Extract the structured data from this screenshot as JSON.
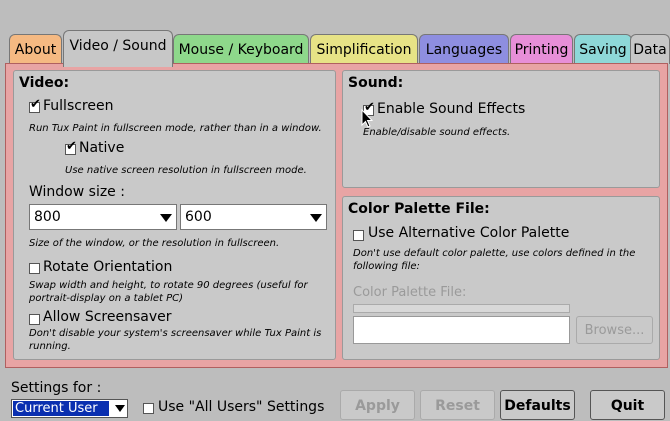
{
  "tabs": [
    {
      "label": "About",
      "color": "#f5b982"
    },
    {
      "label": "Video / Sound",
      "color": "#c7c7c7"
    },
    {
      "label": "Mouse / Keyboard",
      "color": "#8ed88b"
    },
    {
      "label": "Simplification",
      "color": "#e7e386"
    },
    {
      "label": "Languages",
      "color": "#8e8ee0"
    },
    {
      "label": "Printing",
      "color": "#e78fd8"
    },
    {
      "label": "Saving",
      "color": "#8ed8d8"
    },
    {
      "label": "Data",
      "color": "#c7c7c7"
    }
  ],
  "active_tab": "Video / Sound",
  "video": {
    "title": "Video:",
    "fullscreen": {
      "label": "Fullscreen",
      "checked": true,
      "help": "Run Tux Paint in fullscreen mode, rather than in a window."
    },
    "native": {
      "label": "Native",
      "checked": true,
      "help": "Use native screen resolution in fullscreen mode."
    },
    "window_size_label": "Window size :",
    "width_value": "800",
    "height_value": "600",
    "size_help": "Size of the window, or the resolution in fullscreen.",
    "rotate": {
      "label": "Rotate Orientation",
      "checked": false,
      "help_line1": "Swap width and height, to rotate 90 degrees (useful for",
      "help_line2": "portrait-display on a tablet PC)"
    },
    "screensaver": {
      "label": "Allow Screensaver",
      "checked": false,
      "help_line1": "Don't disable your system's screensaver while Tux Paint is",
      "help_line2": "running."
    }
  },
  "sound": {
    "title": "Sound:",
    "enable": {
      "label": "Enable Sound Effects",
      "checked": true,
      "help": "Enable/disable sound effects."
    }
  },
  "palette": {
    "title": "Color Palette File:",
    "use_alt": {
      "label": "Use Alternative Color Palette",
      "checked": false,
      "help_line1": "Don't use default color palette, use colors defined in the",
      "help_line2": "following file:"
    },
    "file_label": "Color Palette File:",
    "file_value": "",
    "browse_label": "Browse..."
  },
  "footer": {
    "settings_for_label": "Settings for :",
    "settings_for_value": "Current User",
    "all_users": {
      "label": "Use \"All Users\" Settings",
      "checked": false
    },
    "apply_label": "Apply",
    "reset_label": "Reset",
    "defaults_label": "Defaults",
    "quit_label": "Quit"
  }
}
